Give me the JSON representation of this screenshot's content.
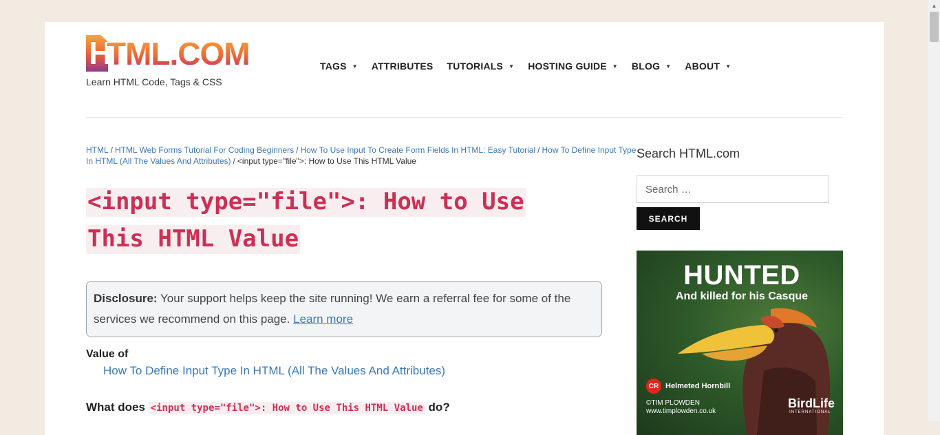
{
  "header": {
    "logo_text": "HTML.COM",
    "tagline": "Learn HTML Code, Tags & CSS"
  },
  "nav": {
    "items": [
      {
        "label": "TAGS",
        "has_dropdown": true
      },
      {
        "label": "ATTRIBUTES",
        "has_dropdown": false
      },
      {
        "label": "TUTORIALS",
        "has_dropdown": true
      },
      {
        "label": "HOSTING GUIDE",
        "has_dropdown": true
      },
      {
        "label": "BLOG",
        "has_dropdown": true
      },
      {
        "label": "ABOUT",
        "has_dropdown": true
      }
    ]
  },
  "breadcrumb": {
    "links": [
      "HTML",
      "HTML Web Forms Tutorial For Coding Beginners",
      "How To Use Input To Create Form Fields In HTML: Easy Tutorial",
      "How To Define Input Type In HTML (All The Values And Attributes)"
    ],
    "current": "<input type=\"file\">: How to Use This HTML Value",
    "separator": "/"
  },
  "article": {
    "title_line1": "<input type=\"file\">: How to Use",
    "title_line2": "This HTML Value",
    "disclosure_label": "Disclosure:",
    "disclosure_text": " Your support helps keep the site running! We earn a referral fee for some of the services we recommend on this page. ",
    "disclosure_link": "Learn more",
    "value_of_label": "Value of",
    "value_of_link": "How To Define Input Type In HTML (All The Values And Attributes)",
    "what_does_prefix": "What does ",
    "what_does_code": "<input type=\"file\">: How to Use This HTML Value",
    "what_does_suffix": " do?"
  },
  "sidebar": {
    "search_title": "Search HTML.com",
    "search_placeholder": "Search …",
    "search_button": "SEARCH"
  },
  "ad": {
    "headline": "HUNTED",
    "subheadline": "And killed for his Casque",
    "badge": "CR",
    "species": "Helmeted Hornbill",
    "credit_line1": "©TIM PLOWDEN",
    "credit_line2": "www.timplowden.co.uk",
    "brand": "BirdLife",
    "brand_sub": "INTERNATIONAL"
  },
  "colors": {
    "page_background": "#f2ebe1",
    "link": "#3b78b8",
    "code_text": "#cc2f55",
    "code_background": "#f8eef0",
    "button_background": "#111111"
  }
}
